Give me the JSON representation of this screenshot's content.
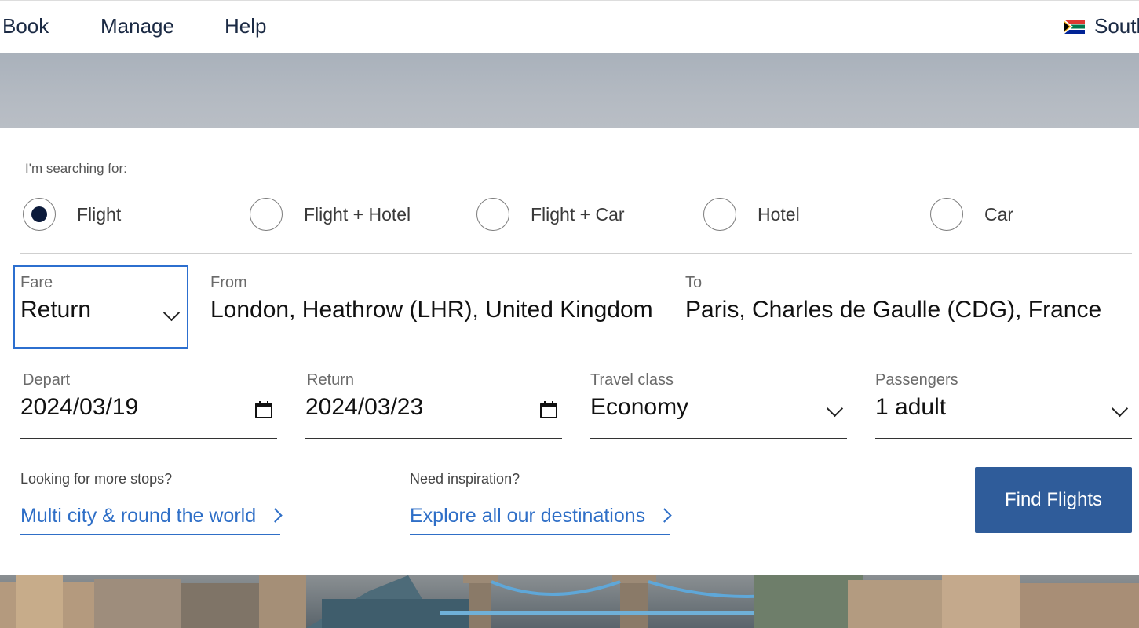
{
  "nav": {
    "items": [
      "Book",
      "Manage",
      "Help"
    ],
    "country_label": "South"
  },
  "search": {
    "label": "I'm searching for:",
    "options": [
      "Flight",
      "Flight + Hotel",
      "Flight + Car",
      "Hotel",
      "Car"
    ],
    "selected": "Flight"
  },
  "fare": {
    "label": "Fare",
    "value": "Return"
  },
  "from": {
    "label": "From",
    "value": "London, Heathrow (LHR), United Kingdom"
  },
  "to": {
    "label": "To",
    "value": "Paris, Charles de Gaulle (CDG), France"
  },
  "depart": {
    "label": "Depart",
    "value": "2024/03/19"
  },
  "return": {
    "label": "Return",
    "value": "2024/03/23"
  },
  "travel_class": {
    "label": "Travel class",
    "value": "Economy"
  },
  "passengers": {
    "label": "Passengers",
    "value": "1 adult"
  },
  "more_stops": {
    "label": "Looking for more stops?",
    "link": "Multi city & round the world"
  },
  "inspiration": {
    "label": "Need inspiration?",
    "link": "Explore all our destinations"
  },
  "find_button": "Find Flights",
  "colors": {
    "accent_blue": "#2c6fcf",
    "button_blue": "#2f5c9a",
    "link_blue": "#2f6fc7",
    "selected_dot": "#0b1a3a"
  }
}
